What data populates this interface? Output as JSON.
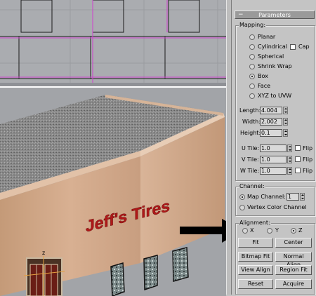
{
  "panel": {
    "title": "Parameters",
    "collapse_glyph": "−",
    "mapping": {
      "title": "Mapping:",
      "options": [
        {
          "label": "Planar",
          "selected": false
        },
        {
          "label": "Cylindrical",
          "selected": false
        },
        {
          "label": "Spherical",
          "selected": false
        },
        {
          "label": "Shrink Wrap",
          "selected": false
        },
        {
          "label": "Box",
          "selected": true
        },
        {
          "label": "Face",
          "selected": false
        },
        {
          "label": "XYZ to UVW",
          "selected": false
        }
      ],
      "cap_label": "Cap",
      "length_label": "Length:",
      "length_value": "4.004",
      "width_label": "Width:",
      "width_value": "2.002",
      "height_label": "Height:",
      "height_value": "0.1",
      "u_tile_label": "U Tile:",
      "u_tile_value": "1.0",
      "v_tile_label": "V Tile:",
      "v_tile_value": "1.0",
      "w_tile_label": "W Tile:",
      "w_tile_value": "1.0",
      "flip_label": "Flip"
    },
    "channel": {
      "title": "Channel:",
      "map_channel_label": "Map Channel:",
      "map_channel_value": "1",
      "vertex_color_label": "Vertex Color Channel"
    },
    "alignment": {
      "title": "Alignment:",
      "x_label": "X",
      "y_label": "Y",
      "z_label": "Z",
      "selected_axis": "Z",
      "fit": "Fit",
      "center": "Center",
      "bitmap_fit": "Bitmap Fit",
      "normal_align": "Normal Align",
      "view_align": "View Align",
      "region_fit": "Region Fit",
      "reset": "Reset",
      "acquire": "Acquire"
    }
  },
  "scene": {
    "sign_text": "Jeff's Tires",
    "sign_color": "#b01818",
    "gizmo_label": "z"
  },
  "colors": {
    "panel_bg": "#c4c4c4",
    "viewport_bg": "#a2a4a8",
    "rollout_header": "#9a9a9a"
  }
}
